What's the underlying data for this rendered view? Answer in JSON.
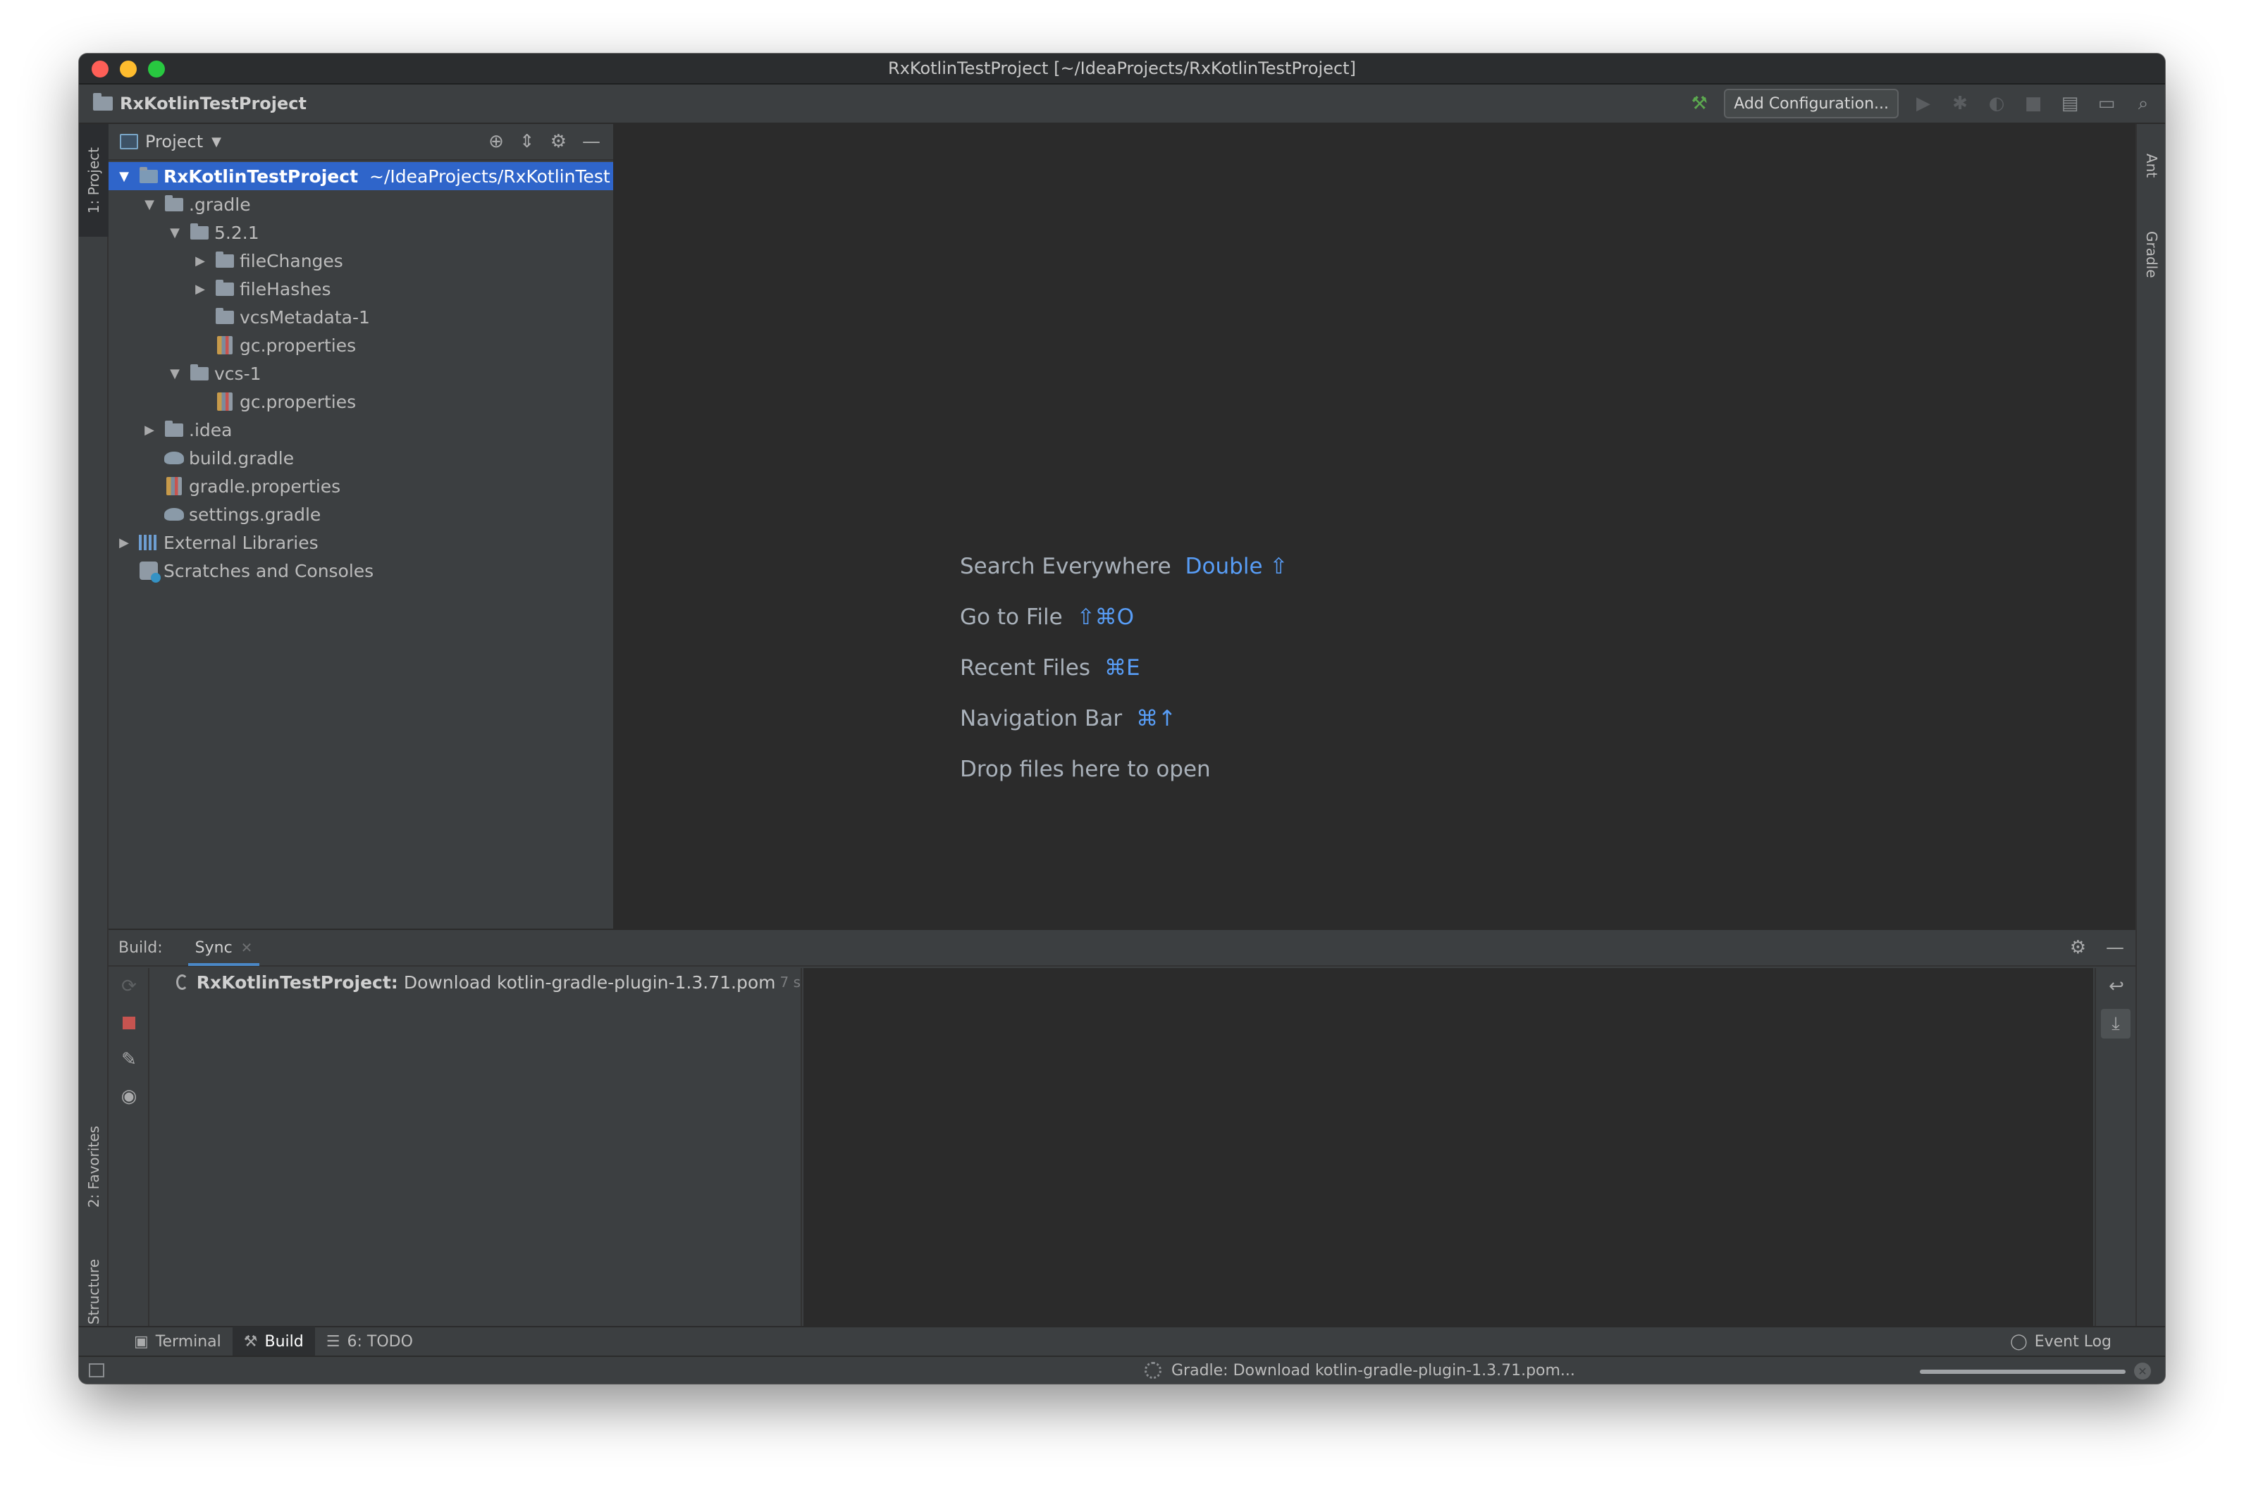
{
  "window": {
    "title": "RxKotlinTestProject [~/IdeaProjects/RxKotlinTestProject]"
  },
  "navbar": {
    "project": "RxKotlinTestProject",
    "add_configuration": "Add Configuration..."
  },
  "left_stripe": {
    "project_tab": "1: Project",
    "favorites_tab": "2: Favorites",
    "structure_tab": "7: Structure"
  },
  "right_stripe": {
    "ant_tab": "Ant",
    "gradle_tab": "Gradle"
  },
  "project_panel": {
    "title": "Project",
    "tree": [
      {
        "name": "RxKotlinTestProject",
        "path": "~/IdeaProjects/RxKotlinTest",
        "depth": 0,
        "arrow": "down",
        "icon": "module-folder",
        "selected": true
      },
      {
        "name": ".gradle",
        "depth": 1,
        "arrow": "down",
        "icon": "folder"
      },
      {
        "name": "5.2.1",
        "depth": 2,
        "arrow": "down",
        "icon": "folder"
      },
      {
        "name": "fileChanges",
        "depth": 3,
        "arrow": "right",
        "icon": "folder"
      },
      {
        "name": "fileHashes",
        "depth": 3,
        "arrow": "right",
        "icon": "folder"
      },
      {
        "name": "vcsMetadata-1",
        "depth": 3,
        "arrow": "",
        "icon": "folder"
      },
      {
        "name": "gc.properties",
        "depth": 3,
        "arrow": "",
        "icon": "properties"
      },
      {
        "name": "vcs-1",
        "depth": 2,
        "arrow": "down",
        "icon": "folder"
      },
      {
        "name": "gc.properties",
        "depth": 3,
        "arrow": "",
        "icon": "properties"
      },
      {
        "name": ".idea",
        "depth": 1,
        "arrow": "right",
        "icon": "folder"
      },
      {
        "name": "build.gradle",
        "depth": 1,
        "arrow": "",
        "icon": "gradle"
      },
      {
        "name": "gradle.properties",
        "depth": 1,
        "arrow": "",
        "icon": "properties"
      },
      {
        "name": "settings.gradle",
        "depth": 1,
        "arrow": "",
        "icon": "gradle"
      },
      {
        "name": "External Libraries",
        "depth": 0,
        "arrow": "right",
        "icon": "libraries"
      },
      {
        "name": "Scratches and Consoles",
        "depth": 0,
        "arrow": "",
        "icon": "scratches"
      }
    ]
  },
  "editor": {
    "hints": [
      {
        "label": "Search Everywhere",
        "key": "Double ⇧"
      },
      {
        "label": "Go to File",
        "key": "⇧⌘O"
      },
      {
        "label": "Recent Files",
        "key": "⌘E"
      },
      {
        "label": "Navigation Bar",
        "key": "⌘↑"
      },
      {
        "label": "Drop files here to open",
        "key": ""
      }
    ]
  },
  "build_panel": {
    "label": "Build:",
    "tab": "Sync",
    "row": {
      "project": "RxKotlinTestProject:",
      "message": "Download kotlin-gradle-plugin-1.3.71.pom",
      "time": "7 s"
    }
  },
  "bottom_tabs": {
    "terminal": "Terminal",
    "build": "Build",
    "todo": "6: TODO",
    "event_log": "Event Log"
  },
  "statusbar": {
    "text": "Gradle: Download kotlin-gradle-plugin-1.3.71.pom...",
    "progress": 1.0
  },
  "colors": {
    "selection": "#2f65ca",
    "shortcut": "#589df6",
    "stop": "#c75450",
    "build_hammer": "#5ca94f"
  }
}
